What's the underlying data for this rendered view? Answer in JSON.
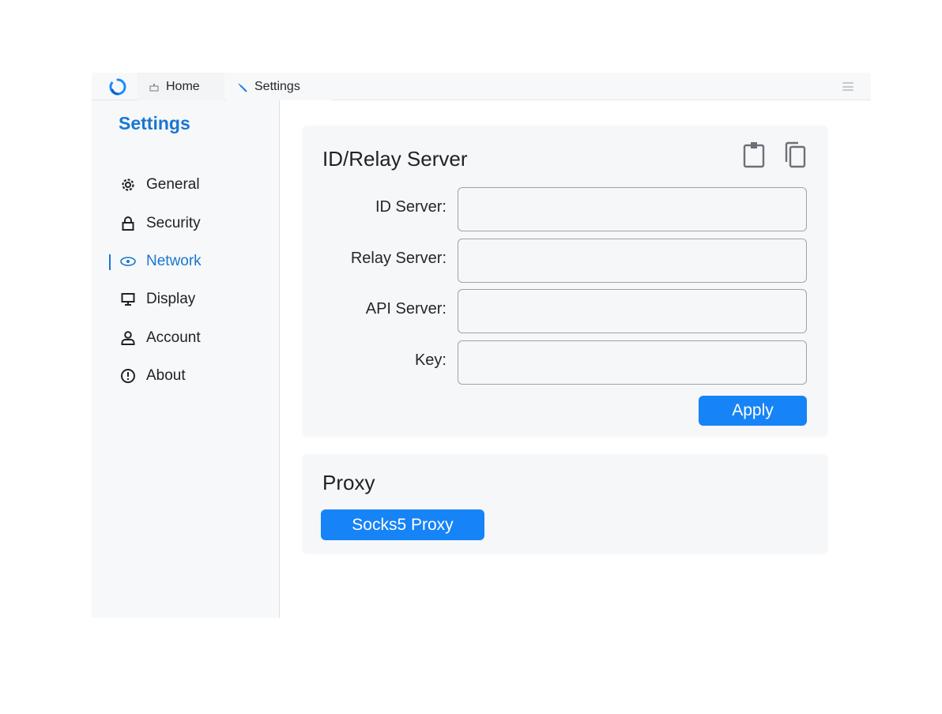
{
  "tabs": [
    {
      "label": "Home",
      "icon": "home-icon"
    },
    {
      "label": "Settings",
      "icon": "wrench-icon"
    }
  ],
  "colors": {
    "accent": "#1976d2",
    "button": "#1683f7"
  },
  "sidebar": {
    "title": "Settings",
    "items": [
      {
        "label": "General",
        "icon": "gear-icon",
        "active": false
      },
      {
        "label": "Security",
        "icon": "lock-icon",
        "active": false
      },
      {
        "label": "Network",
        "icon": "network-icon",
        "active": true
      },
      {
        "label": "Display",
        "icon": "monitor-icon",
        "active": false
      },
      {
        "label": "Account",
        "icon": "user-icon",
        "active": false
      },
      {
        "label": "About",
        "icon": "info-icon",
        "active": false
      }
    ]
  },
  "relay_card": {
    "title": "ID/Relay Server",
    "fields": [
      {
        "label": "ID Server:",
        "value": ""
      },
      {
        "label": "Relay Server:",
        "value": ""
      },
      {
        "label": "API Server:",
        "value": ""
      },
      {
        "label": "Key:",
        "value": ""
      }
    ],
    "apply_label": "Apply"
  },
  "proxy_card": {
    "title": "Proxy",
    "button_label": "Socks5 Proxy"
  }
}
